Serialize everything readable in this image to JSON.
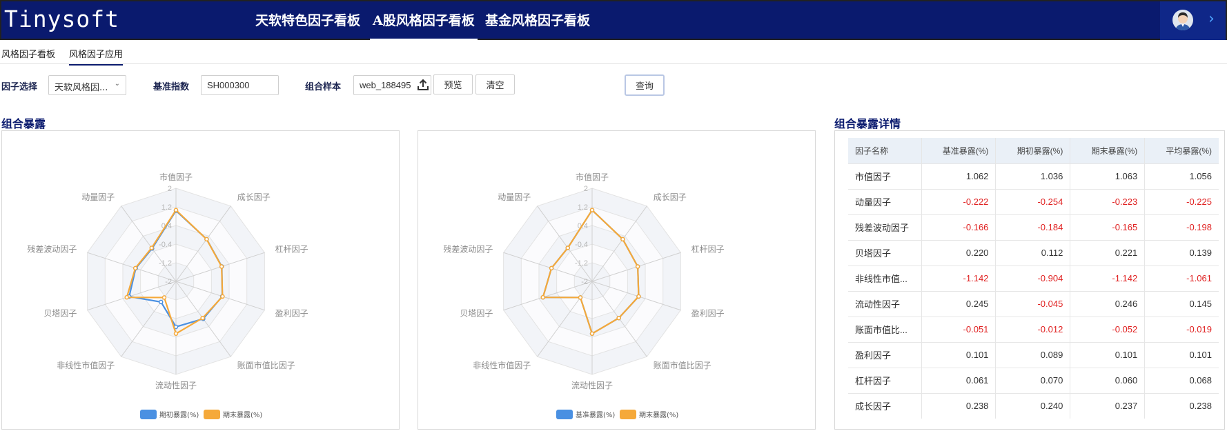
{
  "app": {
    "logo": "Tinysoft",
    "nav_tabs": [
      "天软特色因子看板",
      "A股风格因子看板",
      "基金风格因子看板"
    ],
    "active_nav": 1
  },
  "subtabs": [
    "风格因子看板",
    "风格因子应用"
  ],
  "active_subtab": 1,
  "form": {
    "factor_label": "因子选择",
    "factor_value": "天软风格因...",
    "benchmark_label": "基准指数",
    "benchmark_value": "SH000300",
    "sample_label": "组合样本",
    "sample_value": "web_188495",
    "preview_button": "预览",
    "clear_button": "清空",
    "query_button": "查询"
  },
  "left_section_title": "组合暴露",
  "right_section_title": "组合暴露详情",
  "chart_data": [
    {
      "type": "radar",
      "axes": [
        "市值因子",
        "成长因子",
        "杠杆因子",
        "盈利因子",
        "账面市值比因子",
        "流动性因子",
        "非线性市值因子",
        "贝塔因子",
        "残差波动因子",
        "动量因子"
      ],
      "ticks": [
        "2",
        "1.2",
        "0.4",
        "-0.4",
        "-1.2",
        "-2"
      ],
      "range": [
        -2,
        2
      ],
      "series": [
        {
          "name": "期初暴露(%)",
          "color": "#4a90e2",
          "values": [
            1.036,
            0.24,
            0.07,
            0.089,
            -0.012,
            -0.045,
            -0.904,
            0.112,
            -0.184,
            -0.254
          ]
        },
        {
          "name": "期末暴露(%)",
          "color": "#f5a93a",
          "values": [
            1.063,
            0.237,
            0.06,
            0.101,
            -0.052,
            0.246,
            -1.142,
            0.221,
            -0.165,
            -0.223
          ]
        }
      ]
    },
    {
      "type": "radar",
      "axes": [
        "市值因子",
        "成长因子",
        "杠杆因子",
        "盈利因子",
        "账面市值比因子",
        "流动性因子",
        "非线性市值因子",
        "贝塔因子",
        "残差波动因子",
        "动量因子"
      ],
      "ticks": [
        "2",
        "1.2",
        "0.4",
        "-0.4",
        "-1.2",
        "-2"
      ],
      "range": [
        -2,
        2
      ],
      "series": [
        {
          "name": "基准暴露(%)",
          "color": "#4a90e2",
          "values": [
            1.062,
            0.238,
            0.061,
            0.101,
            -0.051,
            0.245,
            -1.142,
            0.22,
            -0.166,
            -0.222
          ]
        },
        {
          "name": "期末暴露(%)",
          "color": "#f5a93a",
          "values": [
            1.063,
            0.237,
            0.06,
            0.101,
            -0.052,
            0.246,
            -1.142,
            0.221,
            -0.165,
            -0.223
          ]
        }
      ]
    }
  ],
  "table": {
    "columns": [
      "因子名称",
      "基准暴露(%)",
      "期初暴露(%)",
      "期末暴露(%)",
      "平均暴露(%)"
    ],
    "rows": [
      [
        "市值因子",
        "1.062",
        "1.036",
        "1.063",
        "1.056"
      ],
      [
        "动量因子",
        "-0.222",
        "-0.254",
        "-0.223",
        "-0.225"
      ],
      [
        "残差波动因子",
        "-0.166",
        "-0.184",
        "-0.165",
        "-0.198"
      ],
      [
        "贝塔因子",
        "0.220",
        "0.112",
        "0.221",
        "0.139"
      ],
      [
        "非线性市值...",
        "-1.142",
        "-0.904",
        "-1.142",
        "-1.061"
      ],
      [
        "流动性因子",
        "0.245",
        "-0.045",
        "0.246",
        "0.145"
      ],
      [
        "账面市值比...",
        "-0.051",
        "-0.012",
        "-0.052",
        "-0.019"
      ],
      [
        "盈利因子",
        "0.101",
        "0.089",
        "0.101",
        "0.101"
      ],
      [
        "杠杆因子",
        "0.061",
        "0.070",
        "0.060",
        "0.068"
      ],
      [
        "成长因子",
        "0.238",
        "0.240",
        "0.237",
        "0.238"
      ]
    ]
  }
}
